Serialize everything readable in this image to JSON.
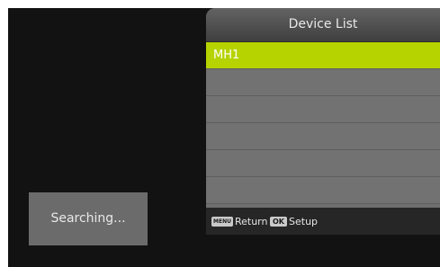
{
  "panel": {
    "title": "Device List",
    "rows": [
      "MH1",
      "",
      "",
      "",
      "",
      "",
      ""
    ],
    "selected_index": 0,
    "footer": {
      "return_key": "MENU",
      "return_label": "Return",
      "setup_key": "OK",
      "setup_label": "Setup"
    }
  },
  "status": {
    "text": "Searching..."
  },
  "colors": {
    "background": "#121212",
    "panel": "#6f6f6f",
    "selected_row": "#b6d300",
    "footer": "#262626"
  }
}
